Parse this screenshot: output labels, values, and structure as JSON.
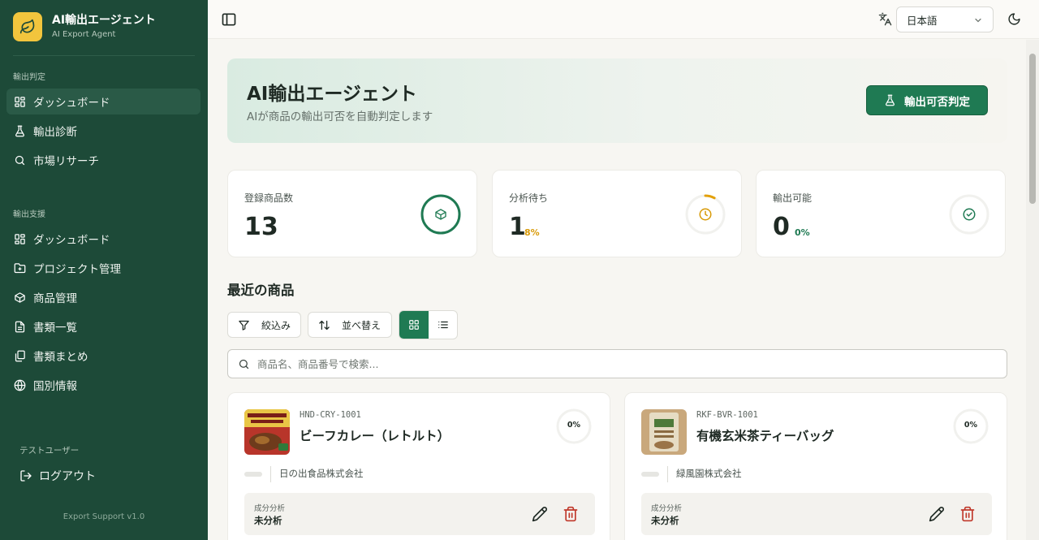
{
  "brand": {
    "title": "AI輸出エージェント",
    "subtitle": "AI Export Agent"
  },
  "sidebar": {
    "section1": "輸出判定",
    "section1_items": [
      {
        "label": "ダッシュボード",
        "icon": "dashboard-icon",
        "active": true
      },
      {
        "label": "輸出診断",
        "icon": "flask-icon"
      },
      {
        "label": "市場リサーチ",
        "icon": "search-icon"
      }
    ],
    "section2": "輸出支援",
    "section2_items": [
      {
        "label": "ダッシュボード",
        "icon": "dashboard-icon"
      },
      {
        "label": "プロジェクト管理",
        "icon": "folder-icon"
      },
      {
        "label": "商品管理",
        "icon": "box-icon"
      },
      {
        "label": "書類一覧",
        "icon": "document-icon"
      },
      {
        "label": "書類まとめ",
        "icon": "files-icon"
      },
      {
        "label": "国別情報",
        "icon": "globe-icon"
      }
    ],
    "user": "テストユーザー",
    "logout": "ログアウト",
    "version": "Export Support v1.0"
  },
  "header": {
    "language": "日本語"
  },
  "hero": {
    "title": "AI輸出エージェント",
    "subtitle": "AIが商品の輸出可否を自動判定します",
    "button": "輸出可否判定"
  },
  "stats": [
    {
      "label": "登録商品数",
      "value": "13",
      "pct": "",
      "progress": 1.0,
      "color": "#1f7a53",
      "icon": "box-icon"
    },
    {
      "label": "分析待ち",
      "value": "1",
      "pct": "8%",
      "progress": 0.08,
      "color": "#e3a008",
      "icon": "clock-icon"
    },
    {
      "label": "輸出可能",
      "value": "0",
      "pct": "0%",
      "progress": 0.0,
      "color": "#1f7a53",
      "icon": "check-circle-icon"
    }
  ],
  "products_section": {
    "title": "最近の商品",
    "filter": "絞込み",
    "sort": "並べ替え",
    "search_placeholder": "商品名、商品番号で検索..."
  },
  "products": [
    {
      "code": "HND-CRY-1001",
      "name": "ビーフカレー（レトルト）",
      "progress": "0%",
      "company": "日の出食品株式会社",
      "status_label": "成分分析",
      "status_value": "未分析"
    },
    {
      "code": "RKF-BVR-1001",
      "name": "有機玄米茶ティーバッグ",
      "progress": "0%",
      "company": "緑風園株式会社",
      "status_label": "成分分析",
      "status_value": "未分析"
    }
  ]
}
